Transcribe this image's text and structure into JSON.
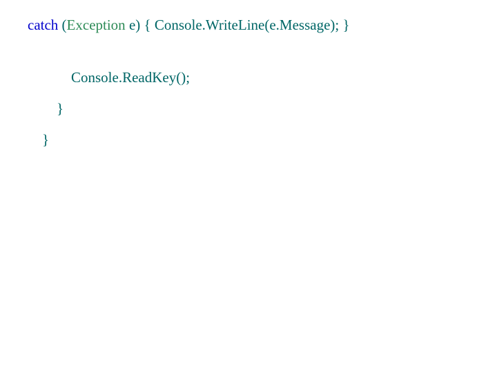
{
  "code": {
    "line1": {
      "catch": "catch",
      "sp1": " ",
      "paren_open": "(",
      "exception_type": "Exception",
      "sp2": " ",
      "exception_var": "e) { Console.WriteLine(e.Message); }"
    },
    "line2": "            Console.ReadKey();",
    "line3": "        }",
    "line4": "    }"
  }
}
